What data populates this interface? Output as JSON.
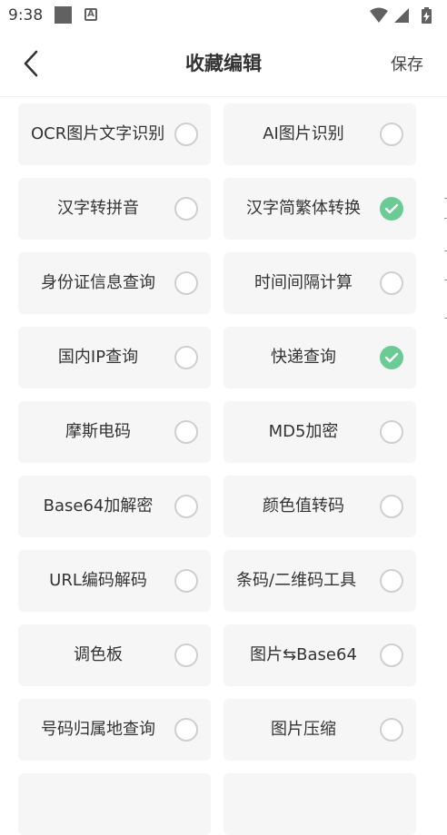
{
  "status_bar": {
    "time": "9:38",
    "a_icon_letter": "A",
    "icons": [
      "notification-square-icon",
      "text-a-icon",
      "wifi-icon",
      "signal-icon",
      "battery-icon"
    ]
  },
  "header": {
    "title": "收藏编辑",
    "save_label": "保存",
    "back_icon": "chevron-left-icon"
  },
  "colors": {
    "checked": "#6ccb94",
    "card_bg": "#f6f6f6",
    "unchecked_border": "#cfcfcf"
  },
  "items": [
    {
      "label": "OCR图片文字识别",
      "checked": false
    },
    {
      "label": "AI图片识别",
      "checked": false
    },
    {
      "label": "汉字转拼音",
      "checked": false
    },
    {
      "label": "汉字简繁体转换",
      "checked": true
    },
    {
      "label": "身份证信息查询",
      "checked": false
    },
    {
      "label": "时间间隔计算",
      "checked": false
    },
    {
      "label": "国内IP查询",
      "checked": false
    },
    {
      "label": "快递查询",
      "checked": true
    },
    {
      "label": "摩斯电码",
      "checked": false
    },
    {
      "label": "MD5加密",
      "checked": false
    },
    {
      "label": "Base64加解密",
      "checked": false
    },
    {
      "label": "颜色值转码",
      "checked": false
    },
    {
      "label": "URL编码解码",
      "checked": false
    },
    {
      "label": "条码/二维码工具",
      "checked": false
    },
    {
      "label": "调色板",
      "checked": false
    },
    {
      "label": "图片⇆Base64",
      "checked": false
    },
    {
      "label": "号码归属地查询",
      "checked": false
    },
    {
      "label": "图片压缩",
      "checked": false
    }
  ]
}
